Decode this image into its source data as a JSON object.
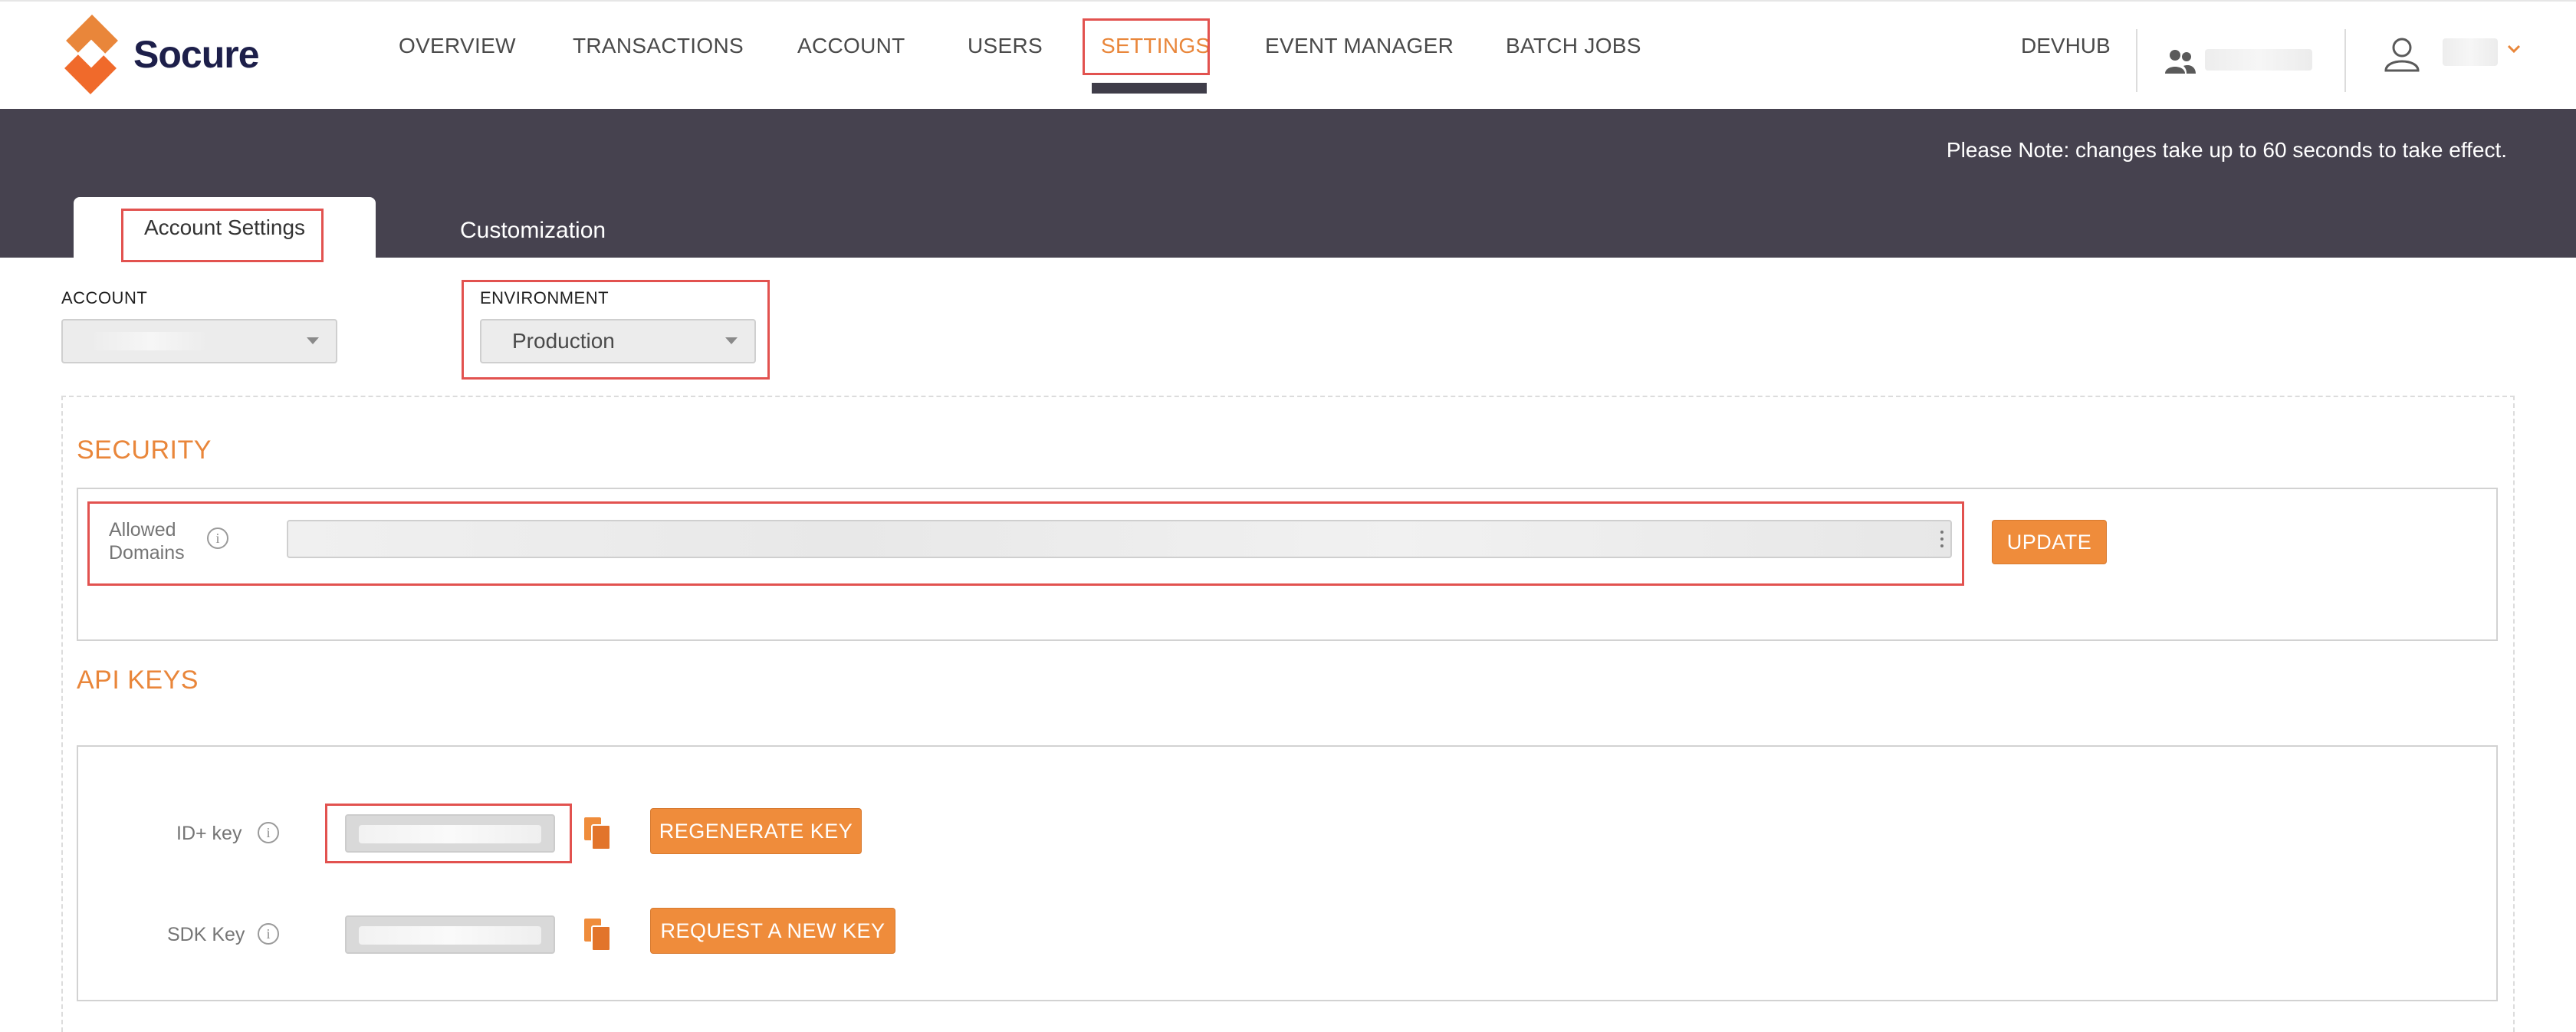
{
  "brand": {
    "name": "Socure",
    "accent": "#e9863a",
    "dark": "#46424f"
  },
  "nav": {
    "items": [
      "OVERVIEW",
      "TRANSACTIONS",
      "ACCOUNT",
      "USERS",
      "SETTINGS",
      "EVENT MANAGER",
      "BATCH JOBS"
    ],
    "active": "SETTINGS",
    "devhub": "DEVHUB"
  },
  "banner": {
    "note": "Please Note: changes take up to 60 seconds to take effect.",
    "tabs": [
      "Account Settings",
      "Customization"
    ],
    "active_tab": "Account Settings"
  },
  "filters": {
    "account_label": "ACCOUNT",
    "environment_label": "ENVIRONMENT",
    "environment_value": "Production"
  },
  "security": {
    "title": "SECURITY",
    "allowed_domains_label": "Allowed Domains",
    "update_label": "UPDATE"
  },
  "api_keys": {
    "title": "API KEYS",
    "id_key_label": "ID+ key",
    "sdk_key_label": "SDK Key",
    "regenerate_label": "REGENERATE KEY",
    "request_label": "REQUEST A NEW KEY"
  },
  "icons": [
    "users-icon",
    "user-icon",
    "chevron-down-icon",
    "info-icon",
    "copy-icon",
    "kebab-icon"
  ]
}
